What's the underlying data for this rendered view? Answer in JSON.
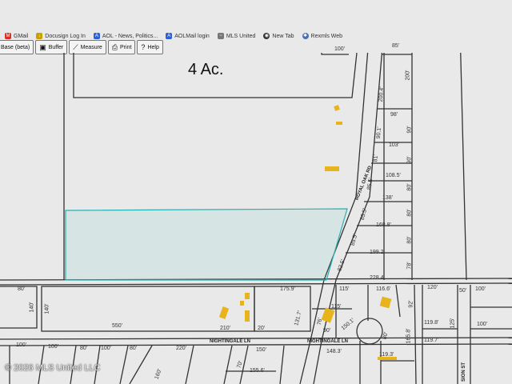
{
  "bookmarks": [
    {
      "label": "GMail",
      "icon": "gmail-icon",
      "color": "#d93025"
    },
    {
      "label": "Docusign Log In",
      "icon": "docusign-icon",
      "color": "#c9a000"
    },
    {
      "label": "AOL - News, Politics...",
      "icon": "aol-icon",
      "color": "#2d5fd6"
    },
    {
      "label": "AOLMail login",
      "icon": "aol-icon",
      "color": "#2d5fd6"
    },
    {
      "label": "MLS United",
      "icon": "mls-icon",
      "color": "#777777"
    },
    {
      "label": "New Tab",
      "icon": "globe-icon",
      "color": "#333333"
    },
    {
      "label": "Rexmls Web",
      "icon": "rexmls-icon",
      "color": "#4a6fb0"
    }
  ],
  "toolbar": {
    "base_label": "Base (beta)",
    "buffer_label": "Buffer",
    "measure_label": "Measure",
    "print_label": "Print",
    "help_label": "Help"
  },
  "map": {
    "acreage": "4 Ac.",
    "streets": {
      "royal_oak": "ROYAL OAK RD",
      "nightingale_1": "NIGHTINGALE LN",
      "nightingale_2": "NIGHTINGALE LN",
      "mission": "SION ST"
    },
    "dims": {
      "d100_top": "100'",
      "d85": "85'",
      "d200_a": "200'",
      "d200_4": "200.4'",
      "d98": "98'",
      "d90_1": "90.1'",
      "d90_a": "90'",
      "d103": "103'",
      "d81": "81'",
      "d90_b": "90'",
      "d108_5": "108.5'",
      "d85_5a": "85.5'",
      "d80_a": "80'",
      "d138": "138'",
      "d85_5b": "85.5'",
      "d80_b": "80'",
      "d168_8": "168.8'",
      "d85_5c": "85.5'",
      "d80_c": "80'",
      "d199_2": "199.2'",
      "d82_5": "82.5'",
      "d78": "78'",
      "d228_4": "228.4'",
      "d80_l": "80'",
      "d140_l": "140'",
      "d175_9": "175.9'",
      "d140_m": "140'",
      "d550": "550'",
      "d210": "210'",
      "d220_a": "220'",
      "d131_7": "131.7'",
      "d115_a": "115'",
      "d116_6": "116.6'",
      "d120": "120'",
      "d50": "50'",
      "d100_r1": "100'",
      "d115_b": "115'",
      "d76": "76'",
      "d90_c": "90'",
      "d150_1": "150.1'",
      "d92": "92'",
      "d80_r": "80'",
      "d165_8": "165.8'",
      "d119_8": "119.8'",
      "d125": "125'",
      "d100_r2": "100'",
      "d119_7": "119.7'",
      "d100_b1": "100'",
      "d100_b2": "100'",
      "d80_b1": "80'",
      "d100_b3": "100'",
      "d80_b2": "80'",
      "d220_b": "220'",
      "d150": "150'",
      "d148_3": "148.3'",
      "d119_3": "119.3'",
      "d155_6": "155.6'",
      "d20": "20'",
      "d70": "70'",
      "d160": "160'"
    }
  },
  "watermark": "© 2026 MLS United LLC"
}
